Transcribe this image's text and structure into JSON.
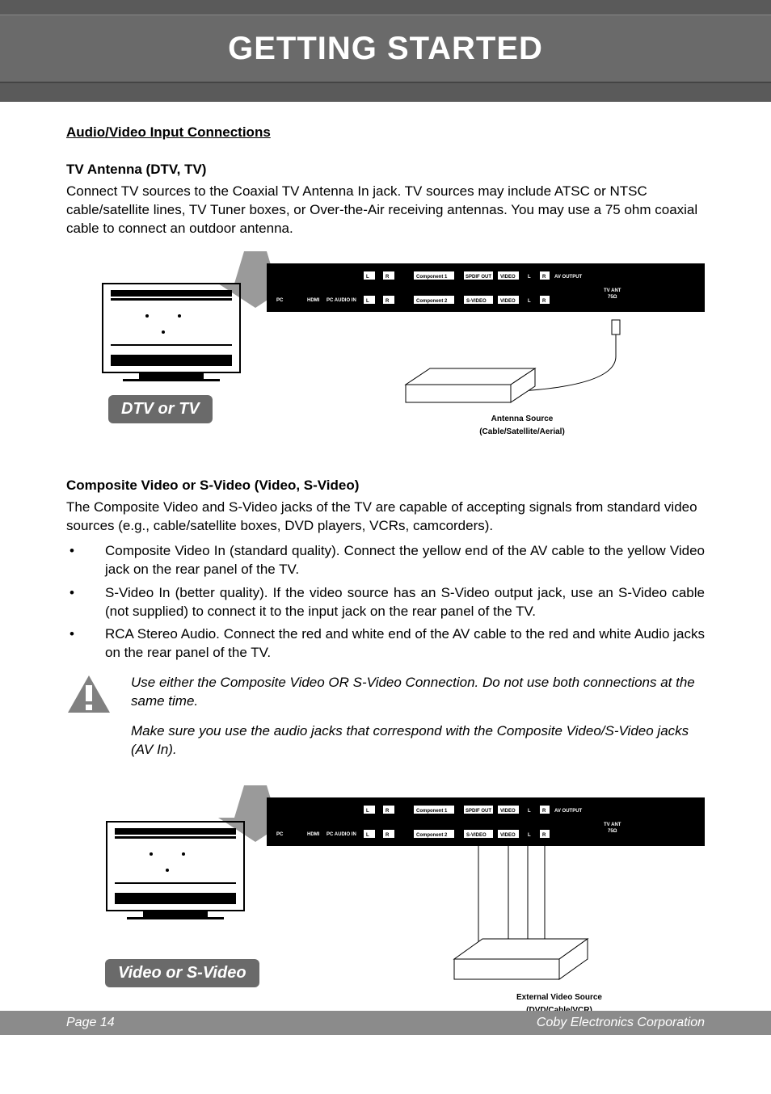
{
  "header": {
    "title": "GETTING STARTED"
  },
  "sectionTitle": "Audio/Video Input Connections",
  "tvAntenna": {
    "heading": "TV Antenna (DTV, TV)",
    "body": "Connect TV sources to the Coaxial TV Antenna In jack. TV sources may include ATSC or NTSC cable/satellite lines, TV Tuner boxes, or Over-the-Air receiving antennas. You may use a 75 ohm coaxial cable to connect an outdoor antenna."
  },
  "diagram1": {
    "pill": "DTV or TV",
    "caption1": "Antenna Source",
    "caption2": "(Cable/Satellite/Aerial)"
  },
  "composite": {
    "heading": "Composite Video or S-Video (Video, S-Video)",
    "body": "The Composite Video and S-Video jacks of the TV are capable of accepting signals from standard video sources (e.g., cable/satellite boxes, DVD players, VCRs, camcorders).",
    "bullets": [
      "Composite Video In (standard quality). Connect the yellow end of the AV cable to the yellow Video jack on the rear panel of the TV.",
      "S-Video In (better quality). If the video source has an S-Video output jack, use an S-Video cable (not supplied) to connect it to the input jack on the rear panel of the TV.",
      "RCA Stereo Audio. Connect the red and white end of the AV cable to the red and white Audio jacks on the rear panel of the TV."
    ]
  },
  "warning": {
    "p1": "Use either the Composite Video OR S-Video Connection. Do not use both connections at the same time.",
    "p2": "Make sure you use the audio jacks that correspond with the Composite Video/S-Video jacks (AV In)."
  },
  "diagram2": {
    "pill": "Video or S-Video",
    "caption1": "External Video Source",
    "caption2": "(DVD/Cable/VCR)"
  },
  "ports": {
    "pc": "PC",
    "hdmi": "HDMI",
    "pcaudio": "PC AUDIO IN",
    "l": "L",
    "r": "R",
    "comp1": "Component 1",
    "comp2": "Component 2",
    "spdif": "SPDIF OUT",
    "video": "VIDEO",
    "svideo": "S-VIDEO",
    "avout": "AV OUTPUT",
    "tvant": "TV ANT",
    "ohm": "75Ω"
  },
  "footer": {
    "left": "Page 14",
    "right": "Coby Electronics Corporation"
  }
}
